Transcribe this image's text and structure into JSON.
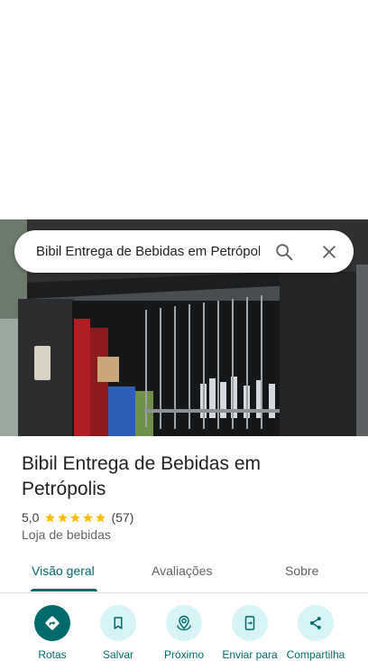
{
  "search": {
    "query": "Bibil Entrega de Bebidas em Petrópolis"
  },
  "place": {
    "name_line1": "Bibil Entrega de Bebidas em",
    "name_line2": "Petrópolis",
    "rating": "5,0",
    "stars": 5,
    "review_count": "(57)",
    "category": "Loja de bebidas"
  },
  "tabs": [
    {
      "label": "Visão geral",
      "active": true
    },
    {
      "label": "Avaliações",
      "active": false
    },
    {
      "label": "Sobre",
      "active": false
    }
  ],
  "actions": [
    {
      "label": "Rotas",
      "icon": "directions-icon"
    },
    {
      "label": "Salvar",
      "icon": "bookmark-icon"
    },
    {
      "label": "Próximo",
      "icon": "nearby-icon"
    },
    {
      "label": "Enviar para",
      "icon": "send-to-phone-icon"
    },
    {
      "label": "Compartilha",
      "icon": "share-icon"
    }
  ],
  "colors": {
    "accent": "#00696b",
    "accent_light": "#d6f3f6",
    "star": "#fbbc04"
  }
}
